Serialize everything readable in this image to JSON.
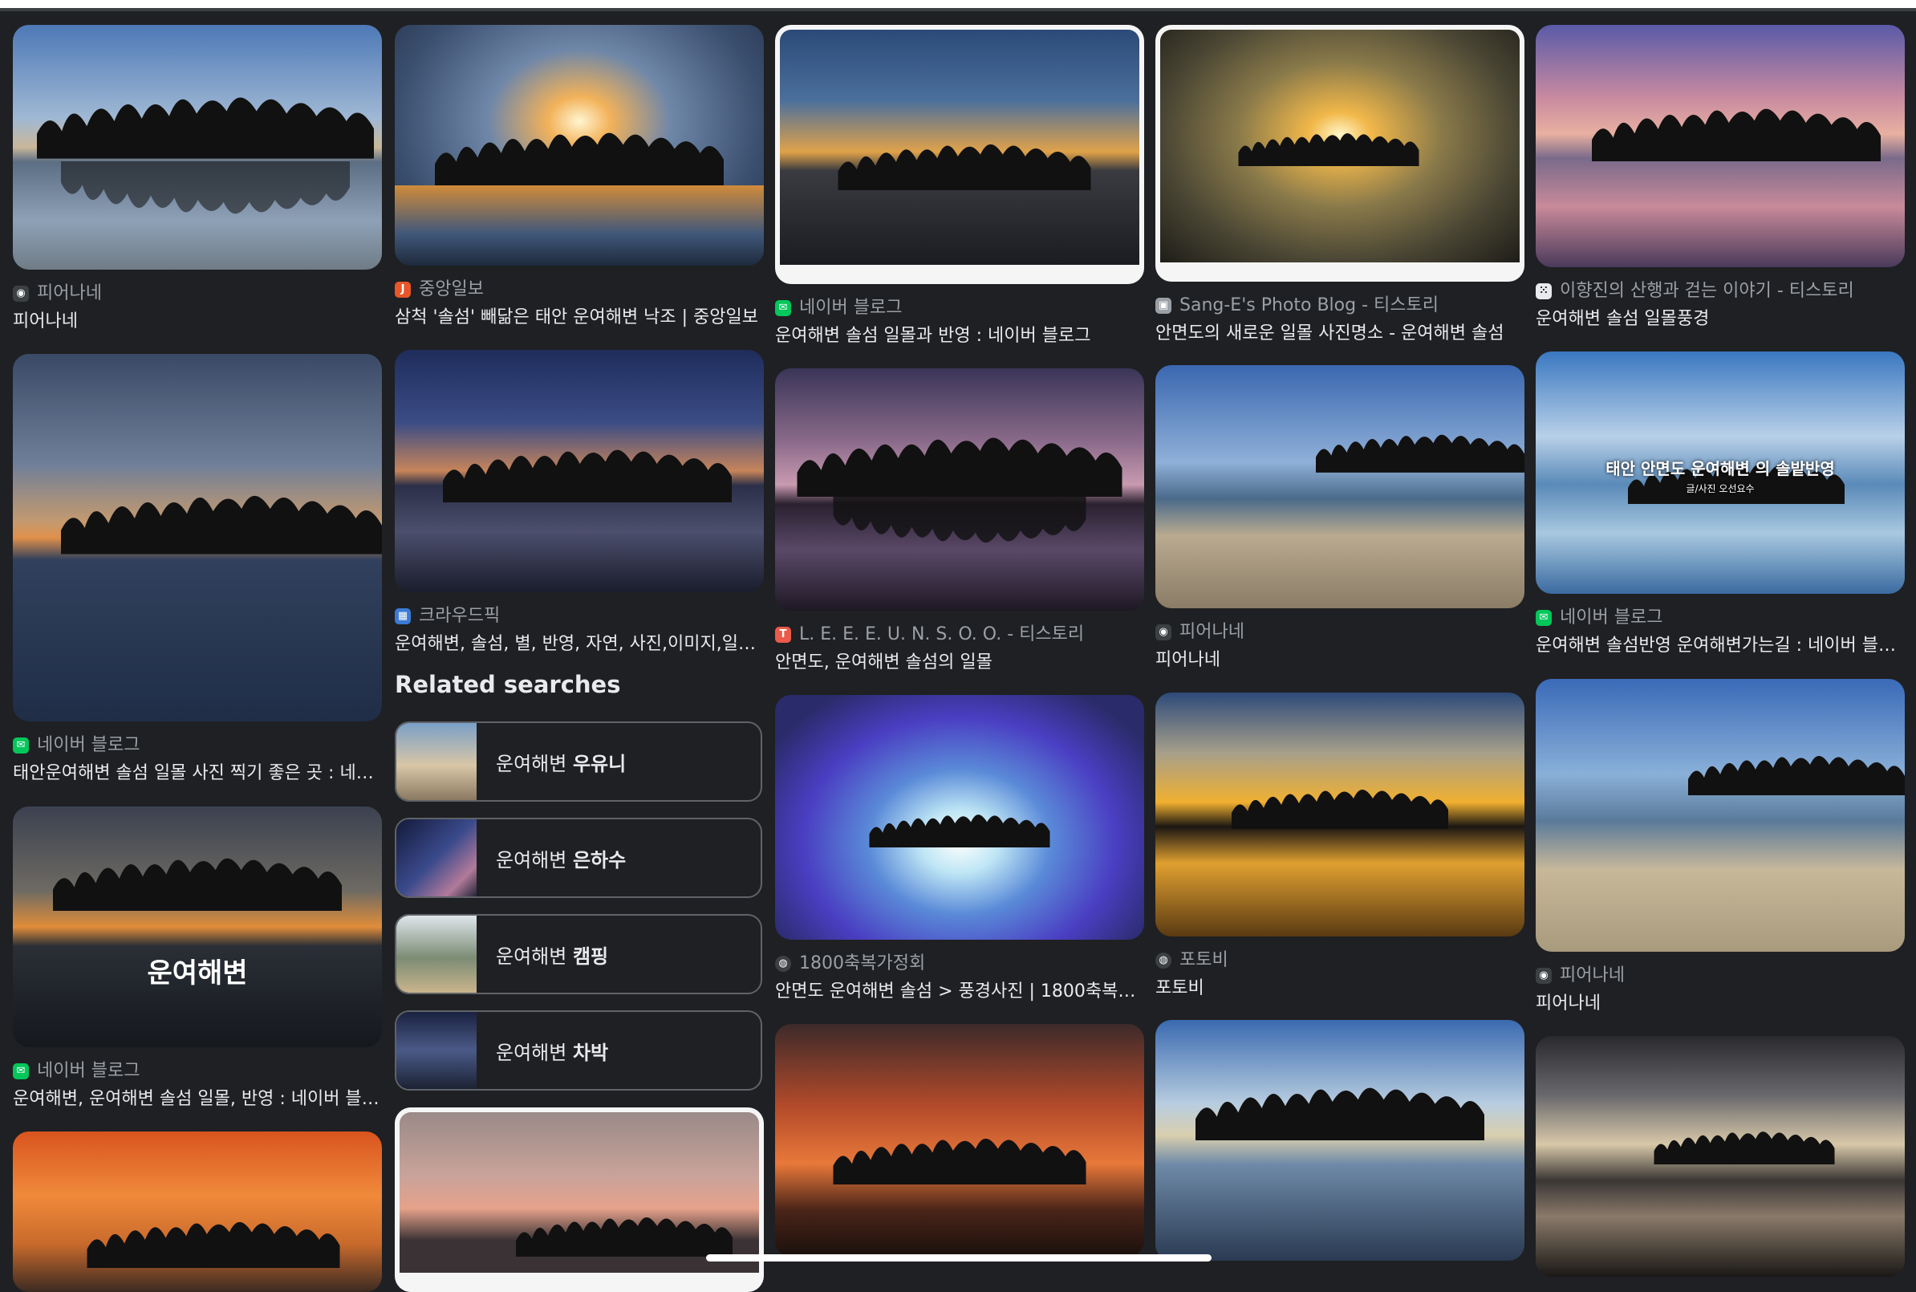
{
  "col1": [
    {
      "source": "피어나네",
      "title": "피어나네",
      "icon": "camera-icon"
    },
    {
      "source": "네이버 블로그",
      "title": "태안운여해변 솔섬 일몰 사진 찍기 좋은 곳 : 네이...",
      "icon": "naver-blog-icon"
    },
    {
      "source": "네이버 블로그",
      "title": "운여해변, 운여해변 솔섬 일몰, 반영 : 네이버 블로...",
      "icon": "naver-blog-icon",
      "overlay": "운여해변"
    }
  ],
  "col2": [
    {
      "source": "중앙일보",
      "title": "삼척 '솔섬' 빼닮은 태안 운여해변 낙조 | 중앙일보",
      "icon": "joongang-icon"
    },
    {
      "source": "크라우드픽",
      "title": "운여해변, 솔섬, 별, 반영, 자연, 사진,이미지,일러...",
      "icon": "crowdpic-icon"
    }
  ],
  "col3": [
    {
      "source": "네이버 블로그",
      "title": "운여해변 솔섬 일몰과 반영 : 네이버 블로그",
      "icon": "naver-blog-icon"
    },
    {
      "source": "L. E. E. E. U. N. S. O. O. - 티스토리",
      "title": "안면도, 운여해변 솔섬의 일몰",
      "icon": "tistory-icon"
    },
    {
      "source": "1800축복가정회",
      "title": "안면도 운여해변 솔섬 > 풍경사진 | 1800축복가...",
      "icon": "globe-icon"
    }
  ],
  "col4": [
    {
      "source": "Sang-E's Photo Blog - 티스토리",
      "title": "안면도의 새로운 일몰 사진명소 - 운여해변 솔섬",
      "icon": "photo-blog-icon"
    },
    {
      "source": "피어나네",
      "title": "피어나네",
      "icon": "camera-icon"
    },
    {
      "source": "포토비",
      "title": "포토비",
      "icon": "globe-icon"
    }
  ],
  "col5": [
    {
      "source": "이향진의 산행과 걷는 이야기 - 티스토리",
      "title": "운여해변 솔섬 일몰풍경",
      "icon": "tistory-icon"
    },
    {
      "source": "네이버 블로그",
      "title": "운여해변 솔섬반영 운여해변가는길 : 네이버 블로...",
      "icon": "naver-blog-icon",
      "overlay": "태안 안면도 운여해변 의 솔밭반영",
      "overlay_sub": "글/사진 오선요수"
    },
    {
      "source": "피어나네",
      "title": "피어나네",
      "icon": "camera-icon"
    }
  ],
  "related": {
    "heading": "Related searches",
    "items": [
      {
        "prefix": "운여해변 ",
        "bold": "우유니"
      },
      {
        "prefix": "운여해변 ",
        "bold": "은하수"
      },
      {
        "prefix": "운여해변 ",
        "bold": "캠핑"
      },
      {
        "prefix": "운여해변 ",
        "bold": "차박"
      }
    ]
  },
  "colors": {
    "background": "#1f2023",
    "naver": "#03c75a",
    "text": "#e8eaed",
    "muted": "#9aa0a6"
  }
}
